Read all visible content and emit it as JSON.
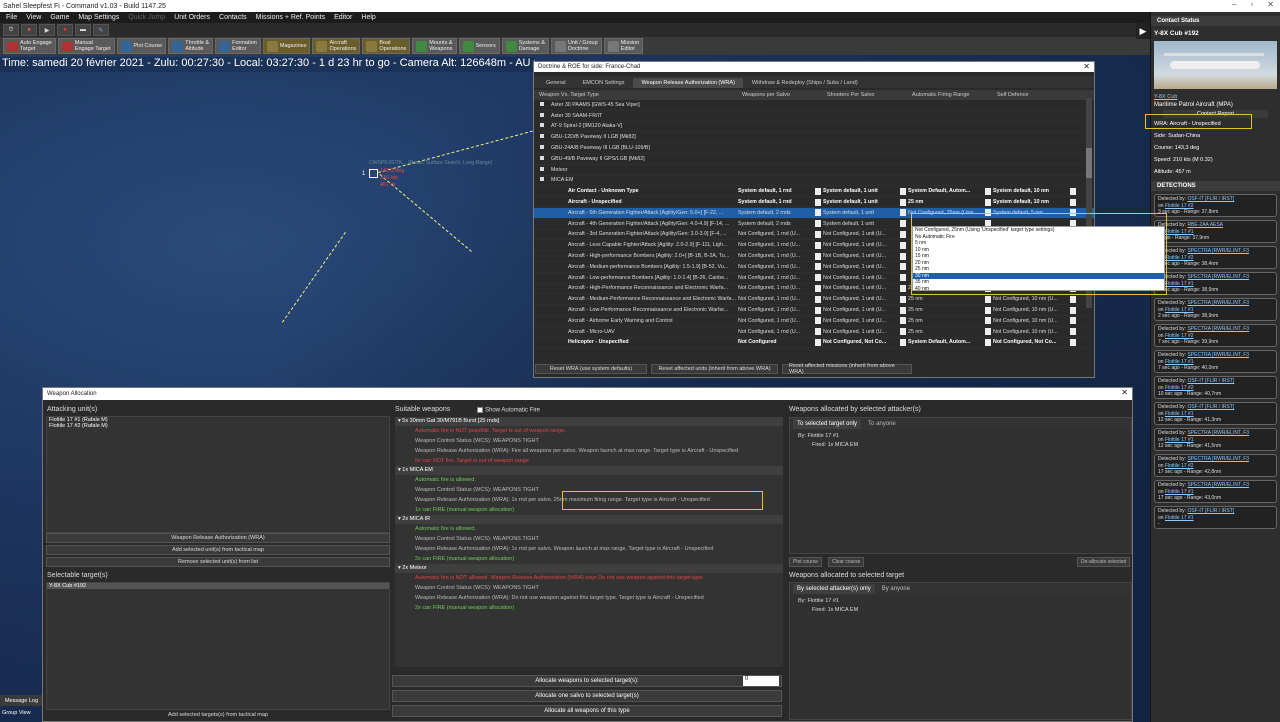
{
  "app_title": "Sahel Sleepfest Fi - Command v1.03 - Build 1147.25",
  "menu": [
    {
      "label": "File"
    },
    {
      "label": "View"
    },
    {
      "label": "Game"
    },
    {
      "label": "Map Settings"
    },
    {
      "label": "Quick Jump"
    },
    {
      "label": "Unit Orders"
    },
    {
      "label": "Contacts"
    },
    {
      "label": "Missions + Ref. Points"
    },
    {
      "label": "Editor"
    },
    {
      "label": "Help"
    }
  ],
  "toolbar2": [
    {
      "label": "Auto Engage\nTarget"
    },
    {
      "label": "Manual\nEngage Target"
    },
    {
      "label": "Plot Course"
    },
    {
      "label": "Throttle &\nAltitude"
    },
    {
      "label": "Formation\nEditor"
    },
    {
      "label": "Magazines"
    },
    {
      "label": "Aircraft\nOperations"
    },
    {
      "label": "Boat\nOperations"
    },
    {
      "label": "Mounts &\nWeapons"
    },
    {
      "label": "Sensors"
    },
    {
      "label": "Systems &\nDamage"
    },
    {
      "label": "Unit / Group\nDoctrine"
    },
    {
      "label": "Mission\nEditor"
    }
  ],
  "time_bar": "Time: samedi 20 février 2021 - Zulu: 00:27:30 - Local: 03:27:30 - 1 d 23 hr to go -  Camera Alt: 126648m  - AU Coun",
  "map_unit": {
    "num": "1",
    "label": "CA/SPS-93/TK... (Radar, Surface Search, Long-Range)",
    "info": [
      "143.3 deg",
      "210 kts",
      "457 m"
    ]
  },
  "contact_status": {
    "header": "Contact Status",
    "name": "Y-8X Cub #192",
    "type_link": "Y-8X Cub",
    "type_desc": "Maritime Patrol Aircraft (MPA)",
    "report": "Contact Report",
    "wra": "WRA: Aircraft - Unspecified",
    "side": "Side: Sudan-China",
    "course": "Course: 143,3 deg",
    "speed": "Speed: 210 kts (M 0.32)",
    "altitude": "Altitude: 457 m"
  },
  "detections_header": "DETECTIONS",
  "detections": [
    {
      "by": "OSF-IT [FLIR / IRST]",
      "on": "Flottile 17 #2",
      "ago": "3 sec ago",
      "range": "Range: 37,8nm"
    },
    {
      "by": "RBE-2AA AESA",
      "on": "Flottile 17 #1",
      "ago": "0 ago",
      "range": "Range: 37,9nm"
    },
    {
      "by": "SPECTRA [RWR/ELINT, F3",
      "on": "Flottile 17 #2",
      "ago": "8 sec ago",
      "range": "Range: 38,4nm"
    },
    {
      "by": "SPECTRA [RWR/ELINT, F3",
      "on": "Flottile 17 #1",
      "ago": "2 sec ago",
      "range": "Range: 38,5nm"
    },
    {
      "by": "SPECTRA [RWR/ELINT, F3",
      "on": "Flottile 17 #1",
      "ago": "2 sec ago",
      "range": "Range: 38,9nm"
    },
    {
      "by": "SPECTRA [RWR/ELINT, F3",
      "on": "Flottile 17 #2",
      "ago": "7 sec ago",
      "range": "Range: 39,9nm"
    },
    {
      "by": "SPECTRA [RWR/ELINT, F3",
      "on": "Flottile 17 #1",
      "ago": "7 sec ago",
      "range": "Range: 40,0nm"
    },
    {
      "by": "OSF-IT [FLIR / IRST]",
      "on": "Flottile 17 #2",
      "ago": "10 sec ago",
      "range": "Range: 40,7nm"
    },
    {
      "by": "OSF-IT [FLIR / IRST]",
      "on": "Flottile 17 #1",
      "ago": "12 sec ago",
      "range": "Range: 41,3nm"
    },
    {
      "by": "SPECTRA [RWR/ELINT, F3",
      "on": "Flottile 17 #1",
      "ago": "12 sec ago",
      "range": "Range: 41,5nm"
    },
    {
      "by": "SPECTRA [RWR/ELINT, F3",
      "on": "Flottile 17 #2",
      "ago": "17 sec ago",
      "range": "Range: 42,8nm"
    },
    {
      "by": "SPECTRA [RWR/ELINT, F3",
      "on": "Flottile 17 #1",
      "ago": "17 sec ago",
      "range": "Range: 43,0nm"
    },
    {
      "by": "OSF-IT [FLIR / IRST]",
      "on": "Flottile 17 #1",
      "ago": "",
      "range": ""
    }
  ],
  "doctrine": {
    "title": "Doctrine & ROE for side: France-Chad",
    "tabs": [
      {
        "label": "General"
      },
      {
        "label": "EMCON Settings"
      },
      {
        "label": "Weapon Release Authorization (WRA)"
      },
      {
        "label": "Withdraw & Redeploy (Ships / Subs / Land)"
      }
    ],
    "columns": [
      "Weapon Vs. Target Type",
      "Weapons per Salvo",
      "Shooters Per Salvo",
      "Automatic Firing Range",
      "Self Defence"
    ],
    "rows": [
      {
        "name": "Aster 30 PAAMS [GWS-45 Sea Viper]",
        "bold": false
      },
      {
        "name": "Aster 30 SAAM-FR/IT",
        "bold": false
      },
      {
        "name": "AT-9 Spiral-2 [9M120 Ataka-V]",
        "bold": false
      },
      {
        "name": "GBU-12D/B Paveway II LGB [Mk82]",
        "bold": false
      },
      {
        "name": "GBU-24A/B Paveway III LGB [BLU-109/B]",
        "bold": false
      },
      {
        "name": "GBU-49/B Paveway II GPS/LGB [Mk82]",
        "bold": false
      },
      {
        "name": "Meteor",
        "bold": false
      },
      {
        "name": "MICA EM",
        "bold": false
      },
      {
        "name": "Air Contact - Unknown Type",
        "bold": true,
        "wps": "System default, 1 rnd",
        "sps": "System default, 1 unit",
        "afr": "System Default, Autom...",
        "sd": "System default, 10 nm"
      },
      {
        "name": "Aircraft - Unspecified",
        "bold": true,
        "wps": "System default, 1 rnd",
        "sps": "System default, 1 unit",
        "afr": "25 nm",
        "sd": "System default, 10 nm"
      },
      {
        "name": "Aircraft - 5th Generation Fighter/Attack [Agility/Gen: 5.0+] [F-22, ...",
        "bold": false,
        "sel": true,
        "wps": "System default, 2 rnds",
        "sps": "System default, 1 unit",
        "afr": "Not Configured, 25nm (Usin",
        "sd": "System default, 5 nm"
      },
      {
        "name": "Aircraft - 4th Generation Fighter/Attack [Agility/Gen: 4.0-4.9] [F-14, ...",
        "bold": false,
        "wps": "System default, 2 rnds",
        "sps": "System default, 1 unit",
        "afr": "",
        "sd": ""
      },
      {
        "name": "Aircraft - 3rd Generation Fighter/Attack [Agility/Gen: 3.0-3.9] [F-4, ...",
        "bold": false,
        "wps": "Not Configured, 1 rnd (U...",
        "sps": "Not Configured, 1 unit (U...",
        "afr": "",
        "sd": ""
      },
      {
        "name": "Aircraft - Less Capable Fighter/Attack [Agility: 2.0-2.9] [F-111, Ligh...",
        "bold": false,
        "wps": "Not Configured, 1 rnd (U...",
        "sps": "Not Configured, 1 unit (U...",
        "afr": "",
        "sd": ""
      },
      {
        "name": "Aircraft - High-performance Bombers [Agility: 2.0+] [B-1B, B-2A, Tu...",
        "bold": false,
        "wps": "Not Configured, 1 rnd (U...",
        "sps": "Not Configured, 1 unit (U...",
        "afr": "",
        "sd": ""
      },
      {
        "name": "Aircraft - Medium-performance Bombers [Agility: 1.5-1.9] [B-52, Vu...",
        "bold": false,
        "wps": "Not Configured, 1 rnd (U...",
        "sps": "Not Configured, 1 unit (U...",
        "afr": "",
        "sd": ""
      },
      {
        "name": "Aircraft - Low-performance Bombers [Agility: 1.0-1.4] [B-26, Canbe...",
        "bold": false,
        "wps": "Not Configured, 1 rnd (U...",
        "sps": "Not Configured, 1 unit (U...",
        "afr": "",
        "sd": ""
      },
      {
        "name": "Aircraft - High-Performance Reconnaissance and Electronic Warfa...",
        "bold": false,
        "wps": "Not Configured, 1 rnd (U...",
        "sps": "Not Configured, 1 unit (U...",
        "afr": "25 nm",
        "sd": "Not Configured, 10 nm (U..."
      },
      {
        "name": "Aircraft - Medium-Performance Reconnaissance and Electronic Warfa...",
        "bold": false,
        "wps": "Not Configured, 1 rnd (U...",
        "sps": "Not Configured, 1 unit (U...",
        "afr": "25 nm",
        "sd": "Not Configured, 10 nm (U..."
      },
      {
        "name": "Aircraft - Low-Performance Reconnaissance and Electronic Warfar...",
        "bold": false,
        "wps": "Not Configured, 1 rnd (U...",
        "sps": "Not Configured, 1 unit (U...",
        "afr": "25 nm",
        "sd": "Not Configured, 10 nm (U..."
      },
      {
        "name": "Aircraft - Airborne Early Warning and Control",
        "bold": false,
        "wps": "Not Configured, 1 rnd (U...",
        "sps": "Not Configured, 1 unit (U...",
        "afr": "25 nm",
        "sd": "Not Configured, 10 nm (U..."
      },
      {
        "name": "Aircraft - Micro-UAV",
        "bold": false,
        "wps": "Not Configured, 1 rnd (U...",
        "sps": "Not Configured, 1 unit (U...",
        "afr": "25 nm",
        "sd": "Not Configured, 10 nm (U..."
      },
      {
        "name": "Helicopter - Unspecified",
        "bold": true,
        "wps": "Not Configured",
        "sps": "Not Configured, Not Co...",
        "afr": "System Default, Autom...",
        "sd": "Not Configured, Not Co..."
      }
    ],
    "dropdown": [
      "Not Configured, 25nm (Using 'Unspecified' target type settings)",
      "No Automatic Fire",
      "5 nm",
      "10 nm",
      "15 nm",
      "20 nm",
      "25 nm",
      "30 nm",
      "35 nm",
      "40 nm"
    ],
    "buttons": [
      {
        "label": "Reset WRA (use system defaults)"
      },
      {
        "label": "Reset affected units (inherit from above WRA)"
      },
      {
        "label": "Reset affected missions (inherit from above WRA)"
      }
    ]
  },
  "weapon_alloc": {
    "title": "Weapon Allocation",
    "attacking_h": "Attacking unit(s)",
    "attackers": [
      "Flottile 17 #1 (Rafale M)",
      "Flottile 17 #2 (Rafale M)"
    ],
    "btns": [
      {
        "label": "Weapon Release Authorization (WRA)"
      },
      {
        "label": "Add selected unit(s) from tactical map"
      },
      {
        "label": "Remove selected unit(s) from list"
      }
    ],
    "selectable_h": "Selectable target(s)",
    "targets": [
      "Y-8X Cub #192"
    ],
    "add_targets": "Add selected targets(s) from tactical map",
    "suitable_h": "Suitable weapons",
    "show_auto": "Show Automatic Fire",
    "weapons": [
      {
        "h": "5x 30mm Gat 30/M791B Burst [25 rnds]",
        "lines": [
          {
            "c": "rd",
            "t": "Automatic fire is NOT possible. Target is out of weapon range."
          },
          {
            "c": "gy",
            "t": "Weapon Control Status (WCS): WEAPONS TIGHT"
          },
          {
            "c": "gy",
            "t": "Weapon Release Authorization (WRA): Fire all weapons per salvo. Weapon launch at max range.  Target type is Aircraft - Unspecified"
          },
          {
            "c": "rd",
            "t": "5x can NOT fire. Target is out of weapon range"
          }
        ]
      },
      {
        "h": "1x MICA EM",
        "lines": [
          {
            "c": "gr0",
            "t": "Automatic fire is allowed."
          },
          {
            "c": "gy",
            "t": "Weapon Control Status (WCS): WEAPONS TIGHT"
          },
          {
            "c": "gy",
            "t": "Weapon Release Authorization (WRA): 1x rnd per salvo. 25nm maximum firing range.  Target type is Aircraft - Unspecified"
          },
          {
            "c": "gr0",
            "t": "1x can FIRE (manual weapon allocation)"
          }
        ]
      },
      {
        "h": "2x MICA IR",
        "lines": [
          {
            "c": "gr0",
            "t": "Automatic fire is allowed."
          },
          {
            "c": "gy",
            "t": "Weapon Control Status (WCS): WEAPONS TIGHT"
          },
          {
            "c": "gy",
            "t": "Weapon Release Authorization (WRA): 1x rnd per salvo. Weapon launch at max range.  Target type is Aircraft - Unspecified"
          },
          {
            "c": "gr0",
            "t": "2x can FIRE (manual weapon allocation)"
          }
        ]
      },
      {
        "h": "2x Meteor",
        "lines": [
          {
            "c": "rd",
            "t": "Automatic fire is NOT allowed. Weapon Release Authorization (WRA) says Do not use weapon against this target type."
          },
          {
            "c": "gy",
            "t": "Weapon Control Status (WCS): WEAPONS TIGHT"
          },
          {
            "c": "gy",
            "t": "Weapon Release Authorization (WRA): Do not use weapon against this target type.  Target type is Aircraft - Unspecified"
          },
          {
            "c": "gr0",
            "t": "2x can FIRE (manual weapon allocation)"
          }
        ]
      }
    ],
    "alloc_btns": [
      {
        "label": "Allocate weapons to selected target(s):"
      },
      {
        "label": "Allocate one salvo to selected target(s)"
      },
      {
        "label": "Allocate all weapons of this type"
      }
    ],
    "alloc_qty": "0",
    "by_attacker_h": "Weapons allocated by selected attacker(s)",
    "tabs_a": [
      "To selected target only",
      "To anyone"
    ],
    "tree_a": [
      "By: Flottile 17 #1",
      "Fired: 1x MICA EM"
    ],
    "plot_course": "Plot course",
    "clear_course": "Clear course",
    "deallocate": "De-allocate selected",
    "to_target_h": "Weapons allocated to selected target",
    "tabs_b": [
      "By selected attacker(s) only",
      "By anyone"
    ],
    "tree_b": [
      "By: Flottile 17 #1",
      "Fired: 1x MICA EM"
    ]
  },
  "message_log": "Message Log",
  "group_view": "Group View"
}
